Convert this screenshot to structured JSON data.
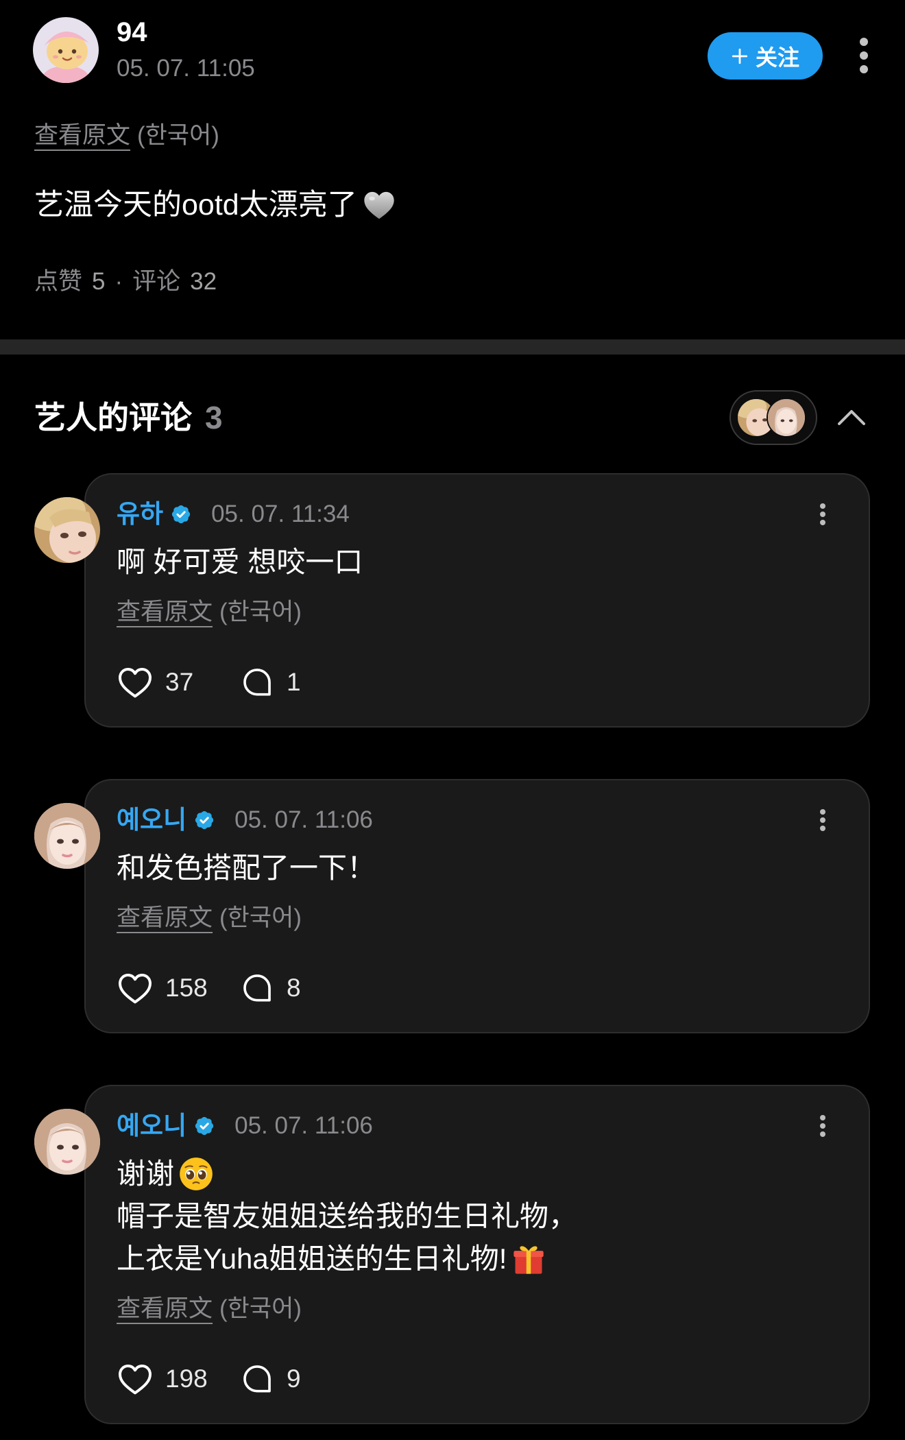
{
  "colors": {
    "background": "#000000",
    "primary_text": "#ffffff",
    "muted_text": "#8a8a8e",
    "divider": "#262626",
    "card_background": "#1a1a1a",
    "card_border": "#2e2e2e",
    "accent_blue": "#1f9bf0",
    "artist_name": "#36a7f2",
    "verified_badge": "#2aa8e6"
  },
  "post": {
    "author_name": "94",
    "timestamp": "05. 07. 11:05",
    "follow_button": {
      "icon": "plus-icon",
      "label": "关注"
    },
    "more_icon": "more-vertical-icon",
    "translation": {
      "link_label": "查看原文",
      "language": "(한국어)"
    },
    "body": {
      "text": "艺温今天的ootd太漂亮了",
      "emoji_icon": "grey-heart-emoji"
    },
    "stats": {
      "likes_label": "点赞",
      "likes": "5",
      "separator": "·",
      "comments_label": "评论",
      "comments": "32"
    }
  },
  "artist_comments": {
    "title": "艺人的评论",
    "count": "3",
    "collapse_icon": "chevron-up-icon",
    "items": [
      {
        "author_name": "유하",
        "verified_icon": "verified-badge-icon",
        "timestamp": "05. 07. 11:34",
        "lines": [
          {
            "text": "啊 好可爱 想咬一口"
          }
        ],
        "translation": {
          "link_label": "查看原文",
          "language": "(한국어)"
        },
        "like_icon": "heart-outline-icon",
        "likes": "37",
        "reply_icon": "comment-bubble-icon",
        "replies": "1"
      },
      {
        "author_name": "예오니",
        "verified_icon": "verified-badge-icon",
        "timestamp": "05. 07. 11:06",
        "lines": [
          {
            "text": "和发色搭配了一下！"
          }
        ],
        "translation": {
          "link_label": "查看原文",
          "language": "(한국어)"
        },
        "like_icon": "heart-outline-icon",
        "likes": "158",
        "reply_icon": "comment-bubble-icon",
        "replies": "8"
      },
      {
        "author_name": "예오니",
        "verified_icon": "verified-badge-icon",
        "timestamp": "05. 07. 11:06",
        "lines": [
          {
            "text": "谢谢",
            "emoji_icon": "pleading-face-emoji"
          },
          {
            "text": "帽子是智友姐姐送给我的生日礼物，"
          },
          {
            "text": "上衣是Yuha姐姐送的生日礼物!",
            "emoji_icon": "wrapped-gift-emoji"
          }
        ],
        "translation": {
          "link_label": "查看原文",
          "language": "(한국어)"
        },
        "like_icon": "heart-outline-icon",
        "likes": "198",
        "reply_icon": "comment-bubble-icon",
        "replies": "9"
      }
    ]
  }
}
